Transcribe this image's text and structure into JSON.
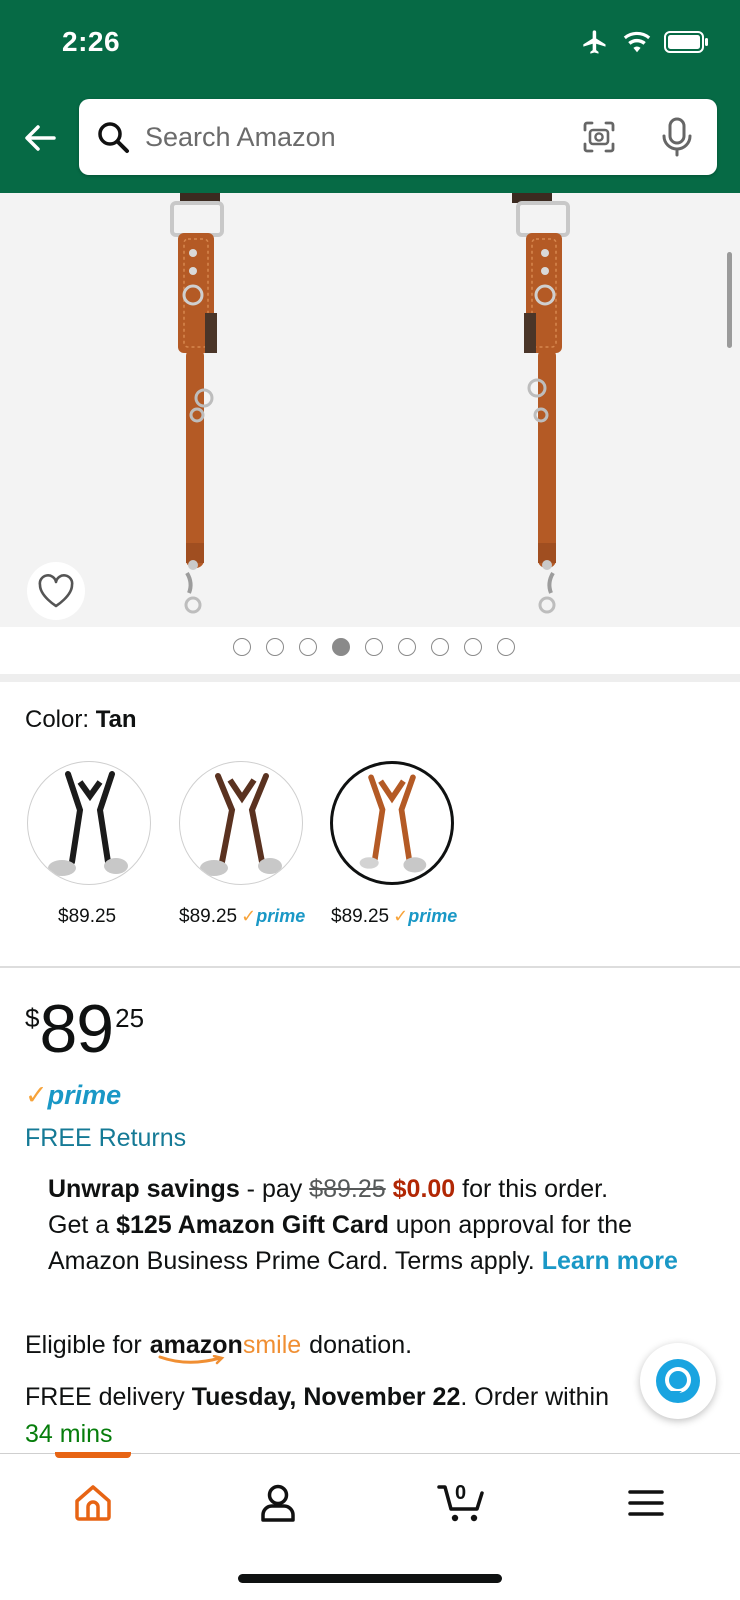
{
  "status_bar": {
    "time": "2:26"
  },
  "search": {
    "placeholder": "Search Amazon"
  },
  "gallery": {
    "image_count": 9,
    "active_index": 3
  },
  "color": {
    "label": "Color:",
    "selected": "Tan"
  },
  "swatches": [
    {
      "price": "$89.25",
      "prime": false
    },
    {
      "price": "$89.25",
      "prime": true
    },
    {
      "price": "$89.25",
      "prime": true
    }
  ],
  "prime_word": "prime",
  "price": {
    "symbol": "$",
    "whole": "89",
    "fraction": "25"
  },
  "free_returns": "FREE Returns",
  "promo": {
    "title": "Unwrap savings",
    "dash_pay": " - pay ",
    "old_price": "$89.25",
    "new_price": "$0.00",
    "after": " for this order.",
    "line2_pre": "Get a ",
    "gift": "$125 Amazon Gift Card",
    "line2_post": " upon approval for the Amazon Business Prime Card. Terms apply. ",
    "learn_more": "Learn more"
  },
  "eligible": {
    "pre": "Eligible for",
    "logo_amazon": "amazon",
    "logo_smile": "smile",
    "post": "donation."
  },
  "delivery": {
    "pre": "FREE delivery ",
    "date": "Tuesday, November 22",
    "post": ". Order within",
    "mins": "34 mins"
  },
  "cart": {
    "count": "0"
  },
  "colors": {
    "header": "#066a45",
    "link": "#157a96",
    "prime": "#1a98c6",
    "deal_red": "#b12704",
    "green_text": "#067d0b",
    "nav_accent": "#e76414"
  }
}
